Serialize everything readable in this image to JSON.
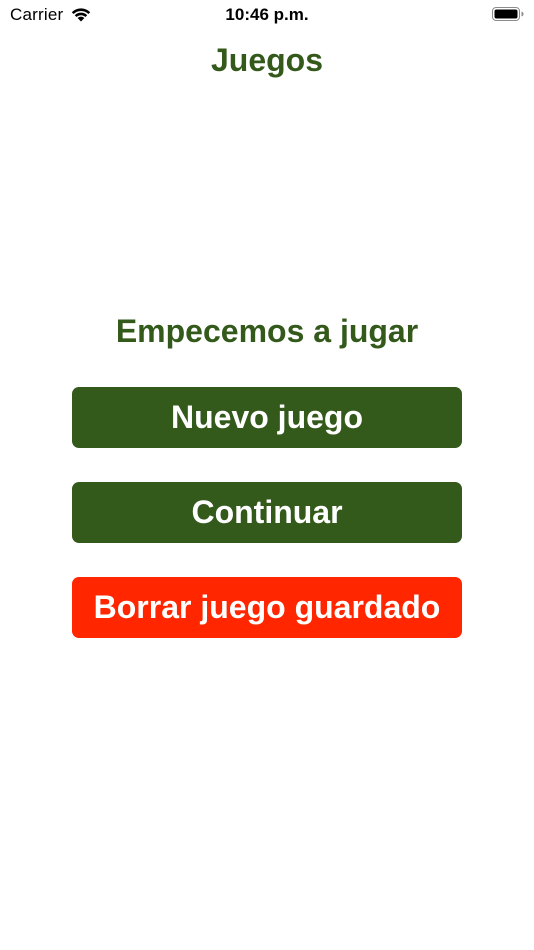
{
  "status_bar": {
    "carrier": "Carrier",
    "time": "10:46 p.m.",
    "wifi_icon": "wifi-icon",
    "battery_icon": "battery-icon"
  },
  "nav": {
    "title": "Juegos"
  },
  "main": {
    "subtitle": "Empecemos a jugar",
    "buttons": {
      "new_game": "Nuevo juego",
      "continue": "Continuar",
      "delete_saved": "Borrar juego guardado"
    }
  },
  "colors": {
    "accent": "#33591b",
    "danger": "#ff2600"
  }
}
